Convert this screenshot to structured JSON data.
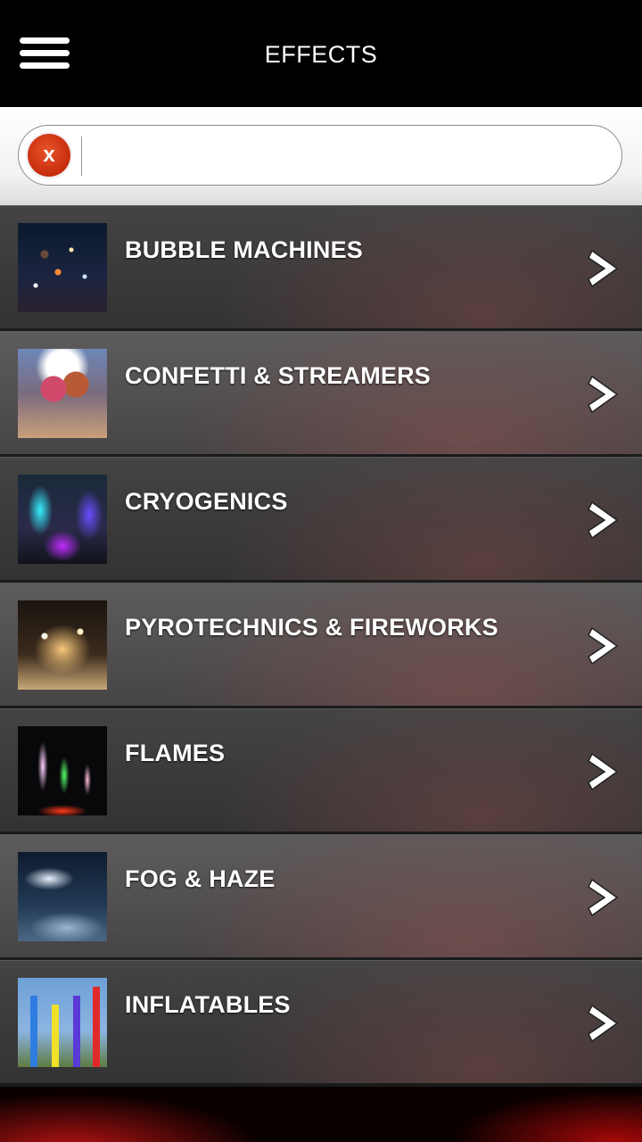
{
  "header": {
    "title": "EFFECTS",
    "menu_icon": "hamburger-menu-icon"
  },
  "search": {
    "clear_label": "x",
    "value": "",
    "placeholder": ""
  },
  "list": {
    "items": [
      {
        "label": "BUBBLE MACHINES",
        "thumb": "bubble-machines-thumbnail"
      },
      {
        "label": "CONFETTI & STREAMERS",
        "thumb": "confetti-streamers-thumbnail"
      },
      {
        "label": "CRYOGENICS",
        "thumb": "cryogenics-thumbnail"
      },
      {
        "label": "PYROTECHNICS & FIREWORKS",
        "thumb": "pyrotechnics-fireworks-thumbnail"
      },
      {
        "label": "FLAMES",
        "thumb": "flames-thumbnail"
      },
      {
        "label": "FOG & HAZE",
        "thumb": "fog-haze-thumbnail"
      },
      {
        "label": "INFLATABLES",
        "thumb": "inflatables-thumbnail"
      }
    ]
  },
  "colors": {
    "header_bg": "#000000",
    "clear_button": "#d53a17",
    "row_text": "#ffffff",
    "footer_accent": "#c81414"
  }
}
